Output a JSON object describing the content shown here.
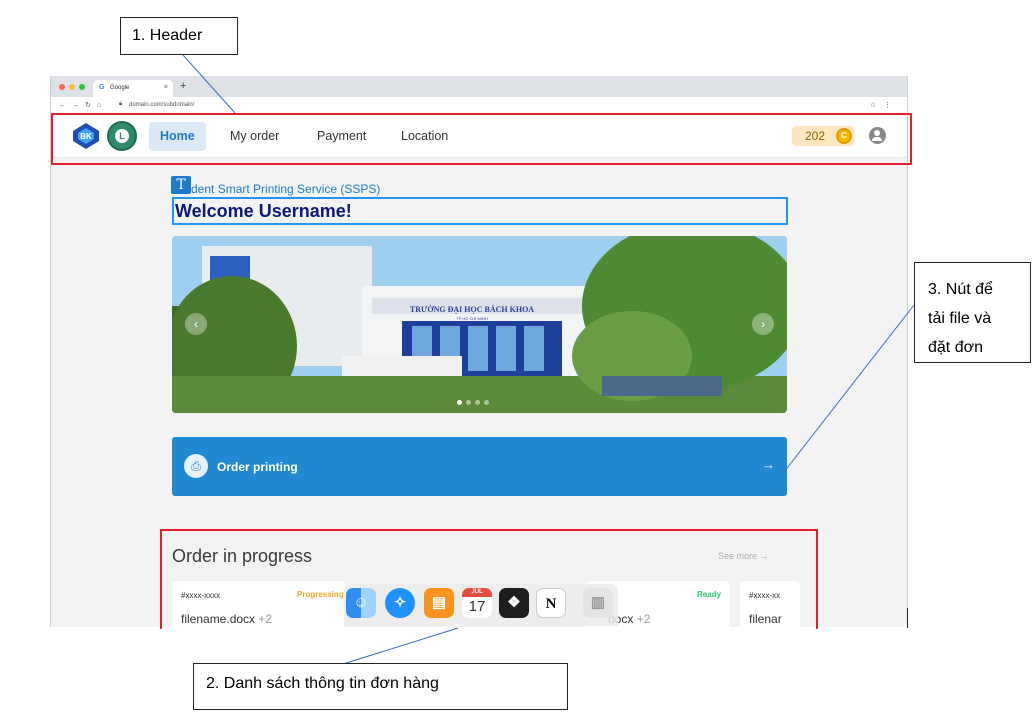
{
  "browser": {
    "tab_title": "Google",
    "tab_favicon": "G",
    "url": "domain.com/subdomain/"
  },
  "header": {
    "nav": [
      {
        "label": "Home",
        "active": true
      },
      {
        "label": "My order",
        "active": false
      },
      {
        "label": "Payment",
        "active": false
      },
      {
        "label": "Location",
        "active": false
      }
    ],
    "coin_count": "202",
    "coin_symbol": "C",
    "accent_color": "#1d7ad1"
  },
  "main": {
    "subtitle": "dent Smart Printing Service (SSPS)",
    "text_tool_glyph": "T",
    "welcome": "Welcome Username!",
    "banner_sign": "TRƯỜNG ĐẠI HỌC BÁCH KHOA",
    "banner_sign_sub": "TP HỒ CHÍ MINH",
    "order_button": "Order printing",
    "order_arrow": "→"
  },
  "orders": {
    "title": "Order in progress",
    "see_more": "See more  →",
    "cards": [
      {
        "id": "#xxxx-xxxx",
        "status": "Progressing",
        "file": "filename.docx",
        "extra": "+2"
      },
      {
        "id": "",
        "status": "Ready",
        "file": "docx",
        "extra": "+2"
      },
      {
        "id": "#xxxx-xx",
        "status": "",
        "file": "filenar",
        "extra": ""
      }
    ]
  },
  "dock": {
    "calendar_month": "JUL",
    "calendar_day": "17"
  },
  "annotations": {
    "header": "1. Header",
    "order_list": "2. Danh sách thông tin đơn hàng",
    "upload_line1": "3. Nút để",
    "upload_line2": "tải file và",
    "upload_line3": "đặt đơn"
  },
  "colors": {
    "annotation_red": "#e0202e",
    "primary_blue": "#1f8ad3",
    "progressing": "#f5a623",
    "ready": "#2ecc71"
  }
}
